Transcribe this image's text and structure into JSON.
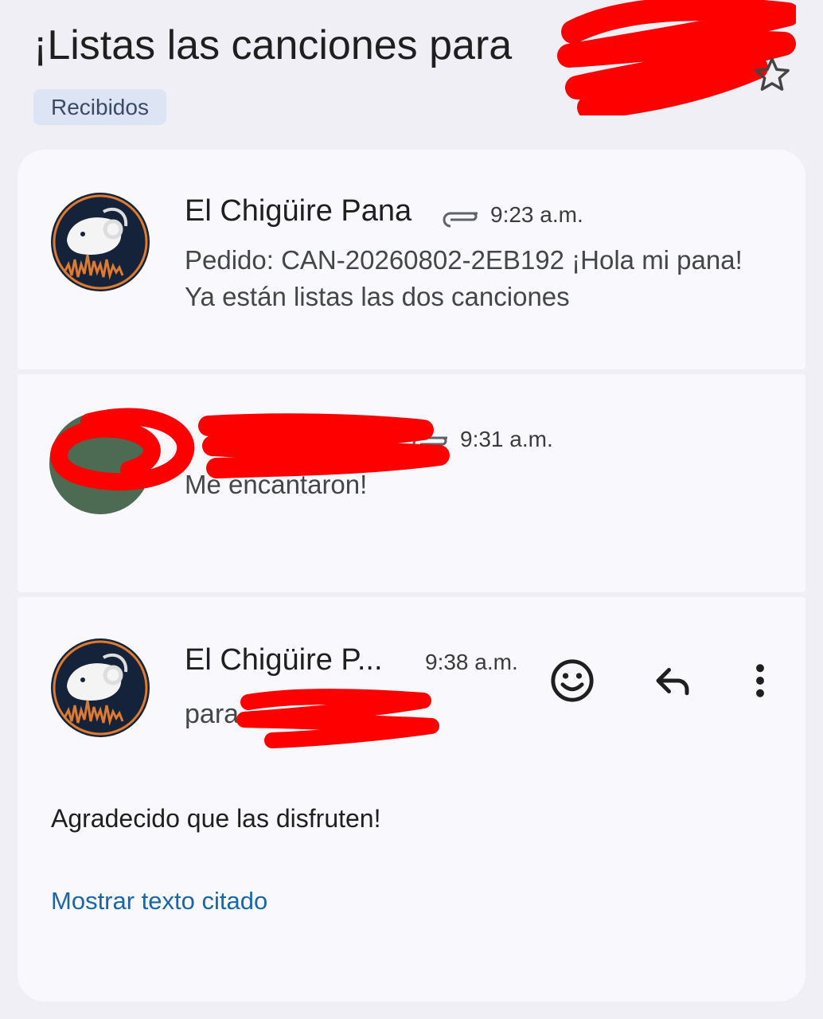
{
  "thread": {
    "subject": "¡Listas las canciones para",
    "label": "Recibidos"
  },
  "messages": [
    {
      "sender": "El Chigüire Pana",
      "time": "9:23 a.m.",
      "snippet": "Pedido: CAN-20260802-2EB192 ¡Hola mi pana! Ya están listas las dos canciones",
      "has_attachment": true
    },
    {
      "sender": "",
      "time": "9:31 a.m.",
      "snippet": "Me encantaron!",
      "has_attachment": true
    },
    {
      "sender": "El Chigüire P...",
      "time": "9:38 a.m.",
      "recipient_prefix": "para",
      "body": "Agradecido que las disfruten!",
      "show_quoted": "Mostrar texto citado"
    }
  ],
  "icons": [
    "star-icon",
    "paperclip-icon",
    "emoji-icon",
    "reply-icon",
    "more-vert-icon",
    "capybara-headphones-avatar"
  ],
  "colors": {
    "link": "#1a66a8",
    "chip_bg": "#dde5f4",
    "redaction": "#ff0000",
    "avatar_bg": "#14233a",
    "avatar_ring": "#e07a2e"
  }
}
